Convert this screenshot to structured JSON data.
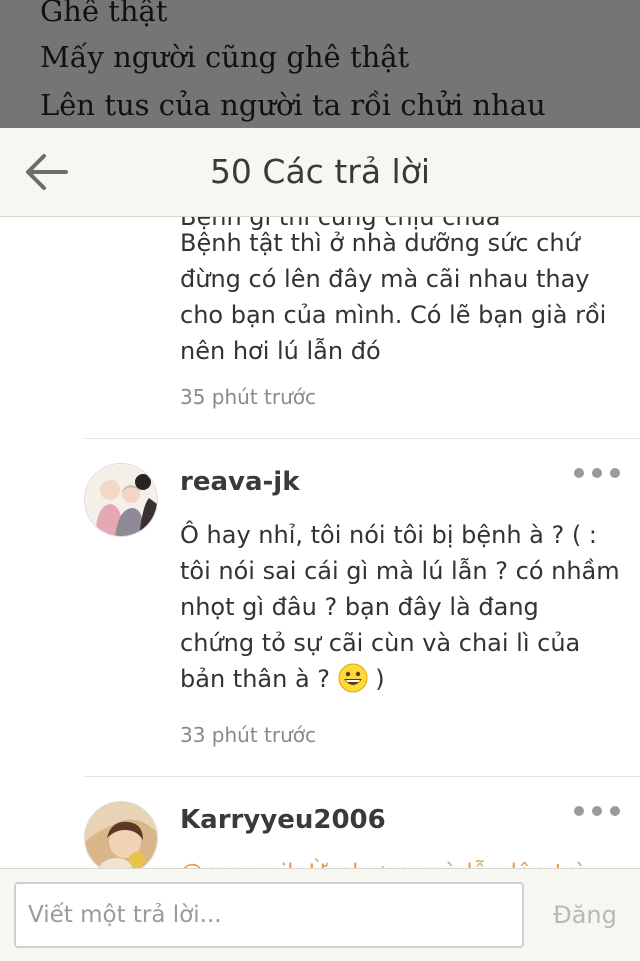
{
  "story": {
    "lines": [
      "Ghê thật",
      "Mấy người cũng ghê thật",
      "Lên tus của người ta rồi chửi nhau"
    ]
  },
  "header": {
    "title": "50 Các trả lời",
    "back_icon": "arrow-left-icon"
  },
  "comments": [
    {
      "partial_first_line": "Bệnh gì thì cũng chịu chữa",
      "text": "Bệnh tật thì ở nhà dưỡng sức chứ đừng có lên đây mà cãi nhau thay cho bạn của mình. Có lẽ bạn già rồi nên hơi lú lẫn đó",
      "time": "35 phút trước"
    },
    {
      "username": "reava-jk",
      "text": "Ô hay nhỉ, tôi nói tôi bị bệnh à ? ( : tôi nói sai cái gì mà lú lẫn ? có nhầm nhọt gì đâu ? bạn đây là đang chứng tỏ sự cãi cùn và chai lì của bản thân à ?",
      "text_end": " )",
      "emoji": "grinning-face-icon",
      "time": "33 phút trước"
    },
    {
      "username": "Karryyeu2006",
      "partial_text": "@reava-jk Ừ nhưng mà lẫn lộn trò"
    }
  ],
  "reply": {
    "placeholder": "Viết một trả lời...",
    "post_label": "Đăng"
  },
  "colors": {
    "header_bg": "#f7f7f2",
    "overlay": "#757575",
    "mention": "#e6a15a",
    "muted": "#8a8a8a"
  }
}
